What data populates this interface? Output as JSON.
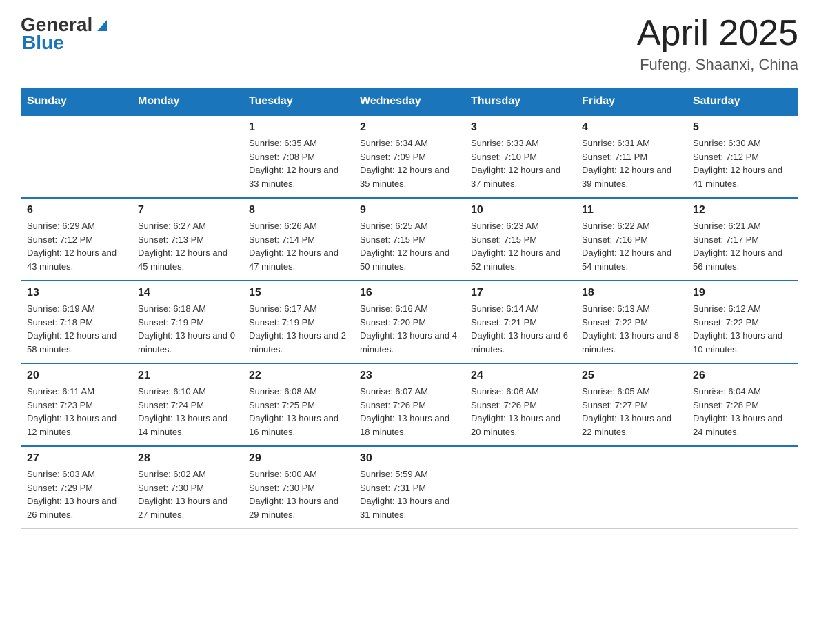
{
  "header": {
    "logo_general": "General",
    "logo_blue": "Blue",
    "title": "April 2025",
    "location": "Fufeng, Shaanxi, China"
  },
  "weekdays": [
    "Sunday",
    "Monday",
    "Tuesday",
    "Wednesday",
    "Thursday",
    "Friday",
    "Saturday"
  ],
  "weeks": [
    [
      {
        "day": "",
        "sunrise": "",
        "sunset": "",
        "daylight": ""
      },
      {
        "day": "",
        "sunrise": "",
        "sunset": "",
        "daylight": ""
      },
      {
        "day": "1",
        "sunrise": "Sunrise: 6:35 AM",
        "sunset": "Sunset: 7:08 PM",
        "daylight": "Daylight: 12 hours and 33 minutes."
      },
      {
        "day": "2",
        "sunrise": "Sunrise: 6:34 AM",
        "sunset": "Sunset: 7:09 PM",
        "daylight": "Daylight: 12 hours and 35 minutes."
      },
      {
        "day": "3",
        "sunrise": "Sunrise: 6:33 AM",
        "sunset": "Sunset: 7:10 PM",
        "daylight": "Daylight: 12 hours and 37 minutes."
      },
      {
        "day": "4",
        "sunrise": "Sunrise: 6:31 AM",
        "sunset": "Sunset: 7:11 PM",
        "daylight": "Daylight: 12 hours and 39 minutes."
      },
      {
        "day": "5",
        "sunrise": "Sunrise: 6:30 AM",
        "sunset": "Sunset: 7:12 PM",
        "daylight": "Daylight: 12 hours and 41 minutes."
      }
    ],
    [
      {
        "day": "6",
        "sunrise": "Sunrise: 6:29 AM",
        "sunset": "Sunset: 7:12 PM",
        "daylight": "Daylight: 12 hours and 43 minutes."
      },
      {
        "day": "7",
        "sunrise": "Sunrise: 6:27 AM",
        "sunset": "Sunset: 7:13 PM",
        "daylight": "Daylight: 12 hours and 45 minutes."
      },
      {
        "day": "8",
        "sunrise": "Sunrise: 6:26 AM",
        "sunset": "Sunset: 7:14 PM",
        "daylight": "Daylight: 12 hours and 47 minutes."
      },
      {
        "day": "9",
        "sunrise": "Sunrise: 6:25 AM",
        "sunset": "Sunset: 7:15 PM",
        "daylight": "Daylight: 12 hours and 50 minutes."
      },
      {
        "day": "10",
        "sunrise": "Sunrise: 6:23 AM",
        "sunset": "Sunset: 7:15 PM",
        "daylight": "Daylight: 12 hours and 52 minutes."
      },
      {
        "day": "11",
        "sunrise": "Sunrise: 6:22 AM",
        "sunset": "Sunset: 7:16 PM",
        "daylight": "Daylight: 12 hours and 54 minutes."
      },
      {
        "day": "12",
        "sunrise": "Sunrise: 6:21 AM",
        "sunset": "Sunset: 7:17 PM",
        "daylight": "Daylight: 12 hours and 56 minutes."
      }
    ],
    [
      {
        "day": "13",
        "sunrise": "Sunrise: 6:19 AM",
        "sunset": "Sunset: 7:18 PM",
        "daylight": "Daylight: 12 hours and 58 minutes."
      },
      {
        "day": "14",
        "sunrise": "Sunrise: 6:18 AM",
        "sunset": "Sunset: 7:19 PM",
        "daylight": "Daylight: 13 hours and 0 minutes."
      },
      {
        "day": "15",
        "sunrise": "Sunrise: 6:17 AM",
        "sunset": "Sunset: 7:19 PM",
        "daylight": "Daylight: 13 hours and 2 minutes."
      },
      {
        "day": "16",
        "sunrise": "Sunrise: 6:16 AM",
        "sunset": "Sunset: 7:20 PM",
        "daylight": "Daylight: 13 hours and 4 minutes."
      },
      {
        "day": "17",
        "sunrise": "Sunrise: 6:14 AM",
        "sunset": "Sunset: 7:21 PM",
        "daylight": "Daylight: 13 hours and 6 minutes."
      },
      {
        "day": "18",
        "sunrise": "Sunrise: 6:13 AM",
        "sunset": "Sunset: 7:22 PM",
        "daylight": "Daylight: 13 hours and 8 minutes."
      },
      {
        "day": "19",
        "sunrise": "Sunrise: 6:12 AM",
        "sunset": "Sunset: 7:22 PM",
        "daylight": "Daylight: 13 hours and 10 minutes."
      }
    ],
    [
      {
        "day": "20",
        "sunrise": "Sunrise: 6:11 AM",
        "sunset": "Sunset: 7:23 PM",
        "daylight": "Daylight: 13 hours and 12 minutes."
      },
      {
        "day": "21",
        "sunrise": "Sunrise: 6:10 AM",
        "sunset": "Sunset: 7:24 PM",
        "daylight": "Daylight: 13 hours and 14 minutes."
      },
      {
        "day": "22",
        "sunrise": "Sunrise: 6:08 AM",
        "sunset": "Sunset: 7:25 PM",
        "daylight": "Daylight: 13 hours and 16 minutes."
      },
      {
        "day": "23",
        "sunrise": "Sunrise: 6:07 AM",
        "sunset": "Sunset: 7:26 PM",
        "daylight": "Daylight: 13 hours and 18 minutes."
      },
      {
        "day": "24",
        "sunrise": "Sunrise: 6:06 AM",
        "sunset": "Sunset: 7:26 PM",
        "daylight": "Daylight: 13 hours and 20 minutes."
      },
      {
        "day": "25",
        "sunrise": "Sunrise: 6:05 AM",
        "sunset": "Sunset: 7:27 PM",
        "daylight": "Daylight: 13 hours and 22 minutes."
      },
      {
        "day": "26",
        "sunrise": "Sunrise: 6:04 AM",
        "sunset": "Sunset: 7:28 PM",
        "daylight": "Daylight: 13 hours and 24 minutes."
      }
    ],
    [
      {
        "day": "27",
        "sunrise": "Sunrise: 6:03 AM",
        "sunset": "Sunset: 7:29 PM",
        "daylight": "Daylight: 13 hours and 26 minutes."
      },
      {
        "day": "28",
        "sunrise": "Sunrise: 6:02 AM",
        "sunset": "Sunset: 7:30 PM",
        "daylight": "Daylight: 13 hours and 27 minutes."
      },
      {
        "day": "29",
        "sunrise": "Sunrise: 6:00 AM",
        "sunset": "Sunset: 7:30 PM",
        "daylight": "Daylight: 13 hours and 29 minutes."
      },
      {
        "day": "30",
        "sunrise": "Sunrise: 5:59 AM",
        "sunset": "Sunset: 7:31 PM",
        "daylight": "Daylight: 13 hours and 31 minutes."
      },
      {
        "day": "",
        "sunrise": "",
        "sunset": "",
        "daylight": ""
      },
      {
        "day": "",
        "sunrise": "",
        "sunset": "",
        "daylight": ""
      },
      {
        "day": "",
        "sunrise": "",
        "sunset": "",
        "daylight": ""
      }
    ]
  ]
}
